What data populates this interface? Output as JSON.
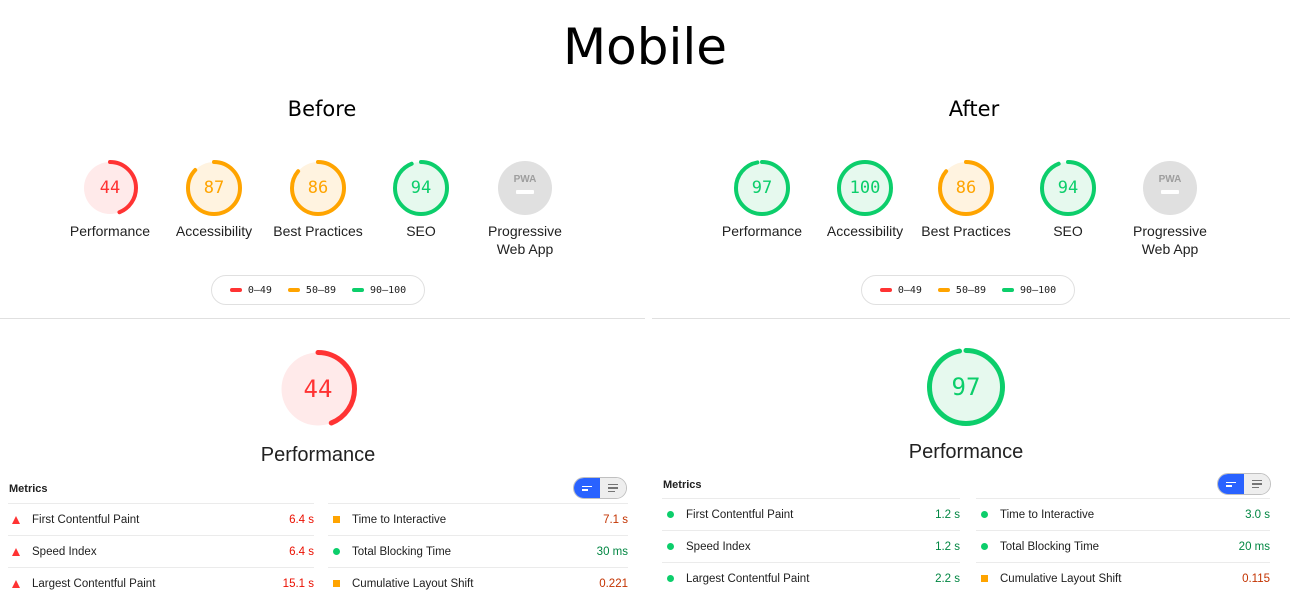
{
  "title": "Mobile",
  "colors": {
    "fail": "#ff3333",
    "average": "#ffa400",
    "pass": "#0cce6b",
    "na": "#bbbbbb",
    "toggle": "#2962ff"
  },
  "legend": [
    {
      "range": "0–49",
      "status": "fail"
    },
    {
      "range": "50–89",
      "status": "average"
    },
    {
      "range": "90–100",
      "status": "pass"
    }
  ],
  "before": {
    "heading": "Before",
    "gauges": [
      {
        "label": "Performance",
        "score": "44",
        "status": "fail"
      },
      {
        "label": "Accessibility",
        "score": "87",
        "status": "average"
      },
      {
        "label": "Best Practices",
        "score": "86",
        "status": "average"
      },
      {
        "label": "SEO",
        "score": "94",
        "status": "pass"
      },
      {
        "label_line1": "Progressive",
        "label_line2": "Web App",
        "badge": "PWA",
        "status": "na"
      }
    ],
    "featured": {
      "label": "Performance",
      "score": "44",
      "status": "fail"
    },
    "metrics_heading": "Metrics",
    "metrics_left": [
      {
        "name": "First Contentful Paint",
        "value": "6.4 s",
        "status": "fail"
      },
      {
        "name": "Speed Index",
        "value": "6.4 s",
        "status": "fail"
      },
      {
        "name": "Largest Contentful Paint",
        "value": "15.1 s",
        "status": "fail"
      }
    ],
    "metrics_right": [
      {
        "name": "Time to Interactive",
        "value": "7.1 s",
        "status": "average"
      },
      {
        "name": "Total Blocking Time",
        "value": "30 ms",
        "status": "pass"
      },
      {
        "name": "Cumulative Layout Shift",
        "value": "0.221",
        "status": "average"
      }
    ]
  },
  "after": {
    "heading": "After",
    "gauges": [
      {
        "label": "Performance",
        "score": "97",
        "status": "pass"
      },
      {
        "label": "Accessibility",
        "score": "100",
        "status": "pass"
      },
      {
        "label": "Best Practices",
        "score": "86",
        "status": "average"
      },
      {
        "label": "SEO",
        "score": "94",
        "status": "pass"
      },
      {
        "label_line1": "Progressive",
        "label_line2": "Web App",
        "badge": "PWA",
        "status": "na"
      }
    ],
    "featured": {
      "label": "Performance",
      "score": "97",
      "status": "pass"
    },
    "metrics_heading": "Metrics",
    "metrics_left": [
      {
        "name": "First Contentful Paint",
        "value": "1.2 s",
        "status": "pass"
      },
      {
        "name": "Speed Index",
        "value": "1.2 s",
        "status": "pass"
      },
      {
        "name": "Largest Contentful Paint",
        "value": "2.2 s",
        "status": "pass"
      }
    ],
    "metrics_right": [
      {
        "name": "Time to Interactive",
        "value": "3.0 s",
        "status": "pass"
      },
      {
        "name": "Total Blocking Time",
        "value": "20 ms",
        "status": "pass"
      },
      {
        "name": "Cumulative Layout Shift",
        "value": "0.115",
        "status": "average"
      }
    ]
  }
}
